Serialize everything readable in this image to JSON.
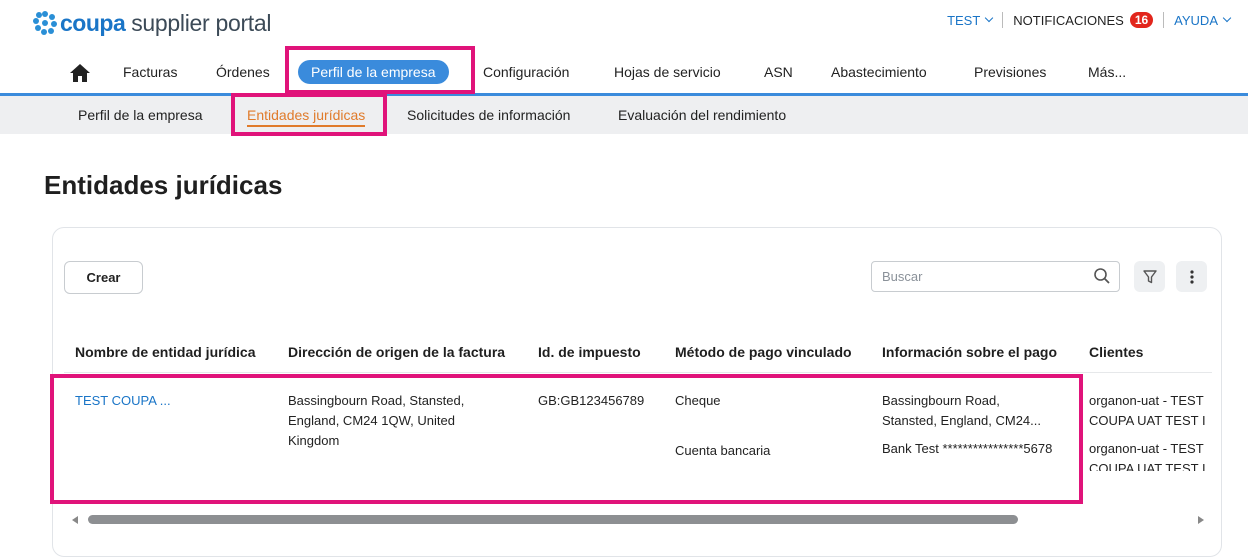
{
  "header": {
    "logo_brand": "coupa",
    "logo_text": "supplier portal",
    "user_menu": "TEST",
    "notifications_label": "NOTIFICACIONES",
    "notifications_count": "16",
    "help_menu": "AYUDA"
  },
  "main_nav": {
    "items": [
      "Facturas",
      "Órdenes",
      "Perfil de la empresa",
      "Configuración",
      "Hojas de servicio",
      "ASN",
      "Abastecimiento",
      "Previsiones",
      "Más..."
    ],
    "active": "Perfil de la empresa"
  },
  "sub_nav": {
    "items": [
      "Perfil de la empresa",
      "Entidades jurídicas",
      "Solicitudes de información",
      "Evaluación del rendimiento"
    ],
    "active": "Entidades jurídicas"
  },
  "page": {
    "title": "Entidades jurídicas"
  },
  "toolbar": {
    "create_label": "Crear",
    "search_placeholder": "Buscar"
  },
  "table": {
    "columns": [
      "Nombre de entidad jurídica",
      "Dirección de origen de la factura",
      "Id. de impuesto",
      "Método de pago vinculado",
      "Información sobre el pago",
      "Clientes"
    ],
    "row": {
      "name": "TEST COUPA ...",
      "address_lines": [
        "Bassingbourn Road, Stansted,",
        "England, CM24 1QW, United",
        "Kingdom"
      ],
      "tax_id": "GB:GB123456789",
      "payment_methods": [
        "Cheque",
        "Cuenta bancaria"
      ],
      "payment_info_1": [
        "Bassingbourn Road,",
        "Stansted, England, CM24..."
      ],
      "payment_info_2": "Bank Test ****************5678",
      "clients_1": [
        "organon-uat - TEST",
        "COUPA UAT TEST I"
      ],
      "clients_2": [
        "organon-uat - TEST",
        "COUPA UAT TEST I"
      ]
    }
  },
  "colors": {
    "accent_blue": "#3a8bdc",
    "active_sub": "#e07b2b",
    "highlight": "#e0137a",
    "badge": "#e2261c"
  }
}
